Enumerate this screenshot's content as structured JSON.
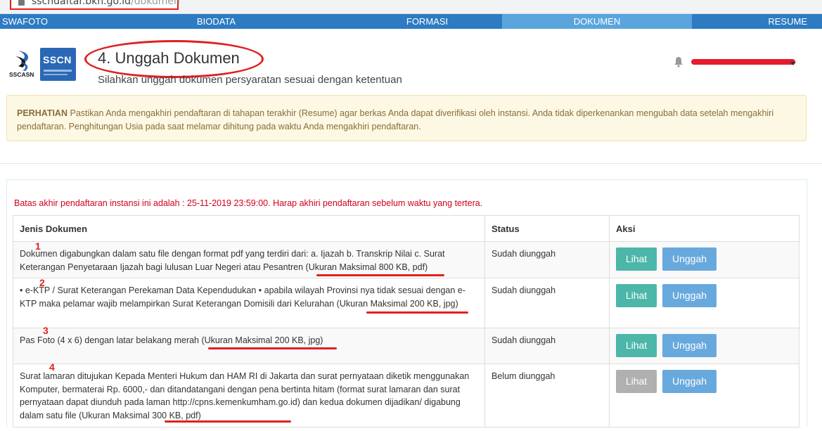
{
  "browser": {
    "url_host": "sscndaftar.bkn.go.id",
    "url_path": "/dokumen"
  },
  "nav": {
    "tabs": [
      {
        "label": "SWAFOTO",
        "active": false
      },
      {
        "label": "BIODATA",
        "active": false
      },
      {
        "label": "FORMASI",
        "active": false
      },
      {
        "label": "DOKUMEN",
        "active": true
      },
      {
        "label": "RESUME",
        "active": false
      }
    ]
  },
  "logos": {
    "sscasn_text": "SSCASN",
    "sscn_text": "SSCN"
  },
  "header": {
    "title": "4. Unggah Dokumen",
    "subtitle": "Silahkan unggah dokumen persyaratan sesuai dengan ketentuan"
  },
  "alert": {
    "label": "PERHATIAN",
    "text": "Pastikan Anda mengakhiri pendaftaran di tahapan terakhir (Resume) agar berkas Anda dapat diverifikasi oleh instansi. Anda tidak diperkenankan mengubah data setelah mengakhiri pendaftaran. Penghitungan Usia pada saat melamar dihitung pada waktu Anda mengakhiri pendaftaran."
  },
  "deadline": "Batas akhir pendaftaran instansi ini adalah : 25-11-2019 23:59:00. Harap akhiri pendaftaran sebelum waktu yang tertera.",
  "table": {
    "headers": [
      "Jenis Dokumen",
      "Status",
      "Aksi"
    ],
    "rows": [
      {
        "marker": "1",
        "desc": "Dokumen digabungkan dalam satu file dengan format pdf yang terdiri dari: a. Ijazah b. Transkrip Nilai c. Surat Keterangan Penyetaraan Ijazah bagi lulusan Luar Negeri atau Pesantren (Ukuran Maksimal 800 KB, pdf)",
        "status": "Sudah diunggah",
        "view_label": "Lihat",
        "upload_label": "Unggah"
      },
      {
        "marker": "2",
        "desc": "• e-KTP / Surat Keterangan Perekaman Data Kependudukan • apabila wilayah Provinsi nya tidak sesuai dengan e-KTP maka pelamar wajib melampirkan Surat Keterangan Domisili dari Kelurahan (Ukuran Maksimal 200 KB, jpg)",
        "status": "Sudah diunggah",
        "view_label": "Lihat",
        "upload_label": "Unggah"
      },
      {
        "marker": "3",
        "desc": "Pas Foto (4 x 6) dengan latar belakang merah (Ukuran Maksimal 200 KB, jpg)",
        "status": "Sudah diunggah",
        "view_label": "Lihat",
        "upload_label": "Unggah"
      },
      {
        "marker": "4",
        "desc": "Surat lamaran ditujukan Kepada Menteri Hukum dan HAM RI di Jakarta dan surat pernyataan diketik menggunakan Komputer, bermaterai Rp. 6000,- dan ditandatangani dengan pena bertinta hitam (format surat lamaran dan surat pernyataan dapat diunduh pada laman http://cpns.kemenkumham.go.id) dan kedua dokumen dijadikan/ digabung dalam satu file (Ukuran Maksimal 300 KB, pdf)",
        "status": "Belum diunggah",
        "view_label": "Lihat",
        "upload_label": "Unggah"
      }
    ]
  },
  "colors": {
    "nav": "#2d7bc2",
    "nav_active": "#5aa5dd",
    "btn_view": "#4cb6a9",
    "btn_view_disabled": "#b0b0b0",
    "btn_upload": "#68a9dd",
    "annotation": "#e02020",
    "deadline": "#d0001c"
  }
}
